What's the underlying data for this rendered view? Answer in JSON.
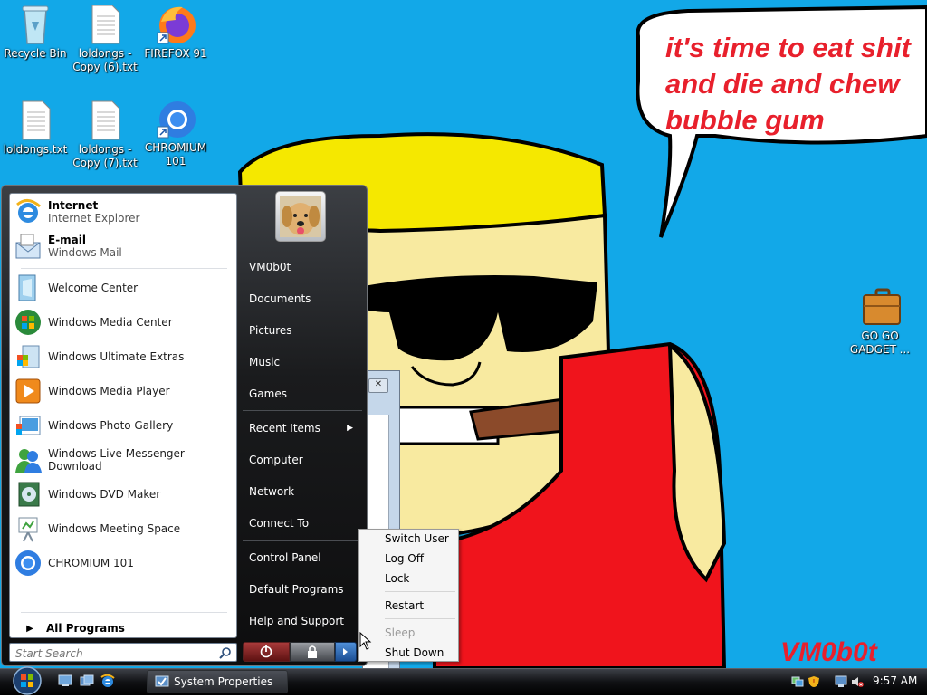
{
  "desktop": {
    "icons": [
      {
        "label": "Recycle Bin"
      },
      {
        "label": "loldongs - Copy (6).txt"
      },
      {
        "label": "FIREFOX 91"
      },
      {
        "label": "loldongs.txt"
      },
      {
        "label": "loldongs - Copy (7).txt"
      },
      {
        "label": "CHROMIUM 101"
      },
      {
        "label": "GO GO GADGET ..."
      }
    ],
    "wallpaper": {
      "speech_lines": [
        "it's time to eat shit",
        "and die and chew",
        "bubble gum"
      ],
      "signature": "VM0b0t",
      "speech_color": "#e8202c"
    }
  },
  "start_menu": {
    "pinned": [
      {
        "title": "Internet",
        "subtitle": "Internet Explorer"
      },
      {
        "title": "E-mail",
        "subtitle": "Windows Mail"
      }
    ],
    "recent": [
      {
        "label": "Welcome Center",
        "icon": "welcome-center-icon"
      },
      {
        "label": "Windows Media Center",
        "icon": "media-center-icon"
      },
      {
        "label": "Windows Ultimate Extras",
        "icon": "ultimate-extras-icon"
      },
      {
        "label": "Windows Media Player",
        "icon": "media-player-icon"
      },
      {
        "label": "Windows Photo Gallery",
        "icon": "photo-gallery-icon"
      },
      {
        "label": "Windows Live Messenger Download",
        "icon": "messenger-icon"
      },
      {
        "label": "Windows DVD Maker",
        "icon": "dvd-maker-icon"
      },
      {
        "label": "Windows Meeting Space",
        "icon": "meeting-space-icon"
      },
      {
        "label": "CHROMIUM 101",
        "icon": "chromium-icon"
      }
    ],
    "all_programs": "All Programs",
    "search_placeholder": "Start Search",
    "right_items": [
      {
        "label": "VM0b0t"
      },
      {
        "label": "Documents"
      },
      {
        "label": "Pictures"
      },
      {
        "label": "Music"
      },
      {
        "label": "Games"
      },
      {
        "label": "Recent Items"
      },
      {
        "label": "Computer"
      },
      {
        "label": "Network"
      },
      {
        "label": "Connect To"
      },
      {
        "label": "Control Panel"
      },
      {
        "label": "Default Programs"
      },
      {
        "label": "Help and Support"
      }
    ]
  },
  "power_menu": {
    "items": [
      {
        "label": "Switch User",
        "enabled": true
      },
      {
        "label": "Log Off",
        "enabled": true
      },
      {
        "label": "Lock",
        "enabled": true
      },
      {
        "label": "Restart",
        "enabled": true
      },
      {
        "label": "Sleep",
        "enabled": false
      },
      {
        "label": "Shut Down",
        "enabled": true
      }
    ]
  },
  "taskbar": {
    "tasks": [
      {
        "label": "System Properties"
      }
    ],
    "clock": "9:57 AM"
  }
}
